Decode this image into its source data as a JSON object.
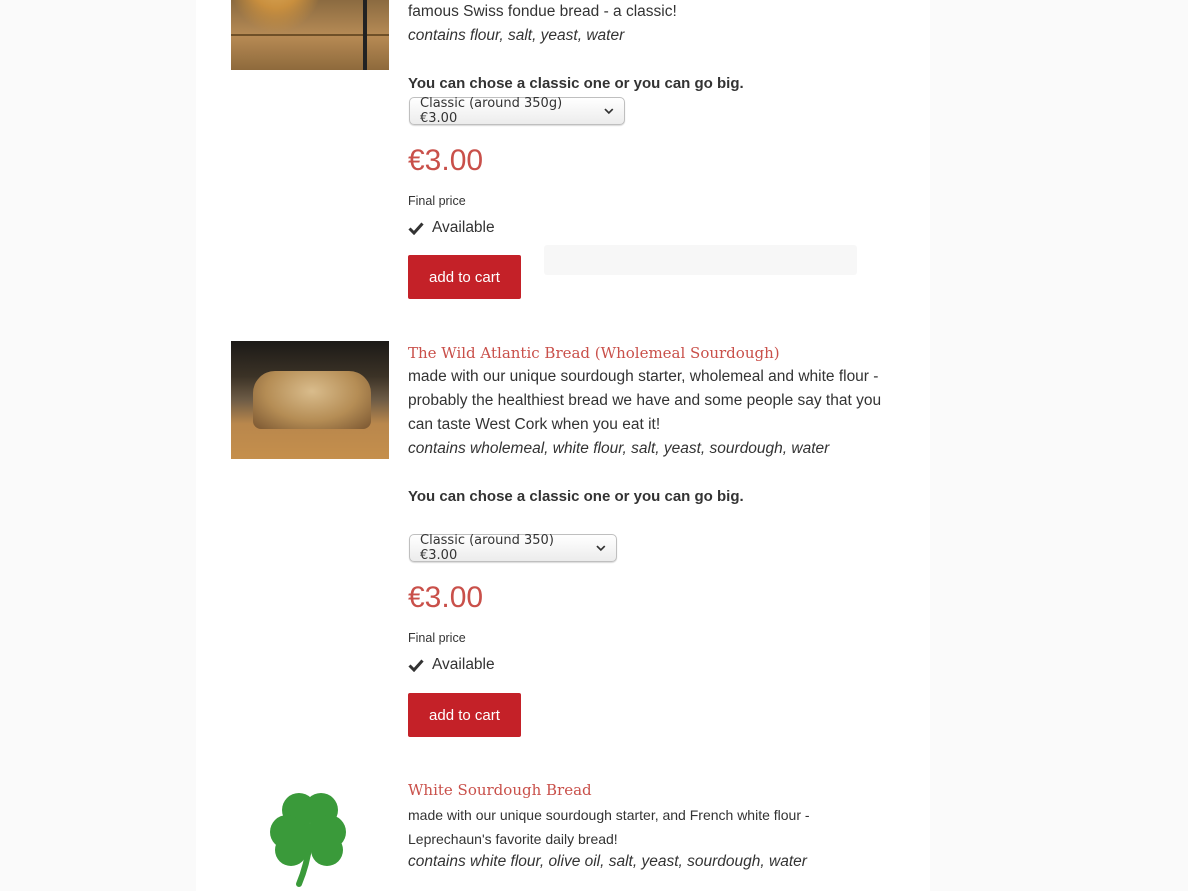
{
  "products": [
    {
      "title": "",
      "description": "famous Swiss fondue bread - a classic!",
      "contains": "contains flour, salt, yeast, water",
      "size_prompt": "You can chose a classic one or you can go big.",
      "size_select": "Classic (around 350g) €3.00",
      "price": "€3.00",
      "final_price_label": "Final price",
      "availability": "Available",
      "cart_label": "add to cart"
    },
    {
      "title": "The Wild Atlantic Bread (Wholemeal Sourdough)",
      "description_lines": [
        "made with our unique sourdough starter, wholemeal and white flour -",
        "probably the healthiest bread we have and some people say that you",
        "can taste West Cork when you eat it!"
      ],
      "contains": "contains wholemeal, white flour, salt, yeast, sourdough, water",
      "size_prompt": "You can chose a classic one or you can go big.",
      "size_select": "Classic (around 350) €3.00",
      "price": "€3.00",
      "final_price_label": "Final price",
      "availability": "Available",
      "cart_label": "add to cart"
    },
    {
      "title": "White Sourdough Bread",
      "description_lines": [
        "made with our unique sourdough starter,  and French white flour -",
        "Leprechaun's favorite daily bread!"
      ],
      "contains": "contains white flour, olive oil, salt, yeast, sourdough, water"
    }
  ],
  "icons": {
    "check": "check-icon",
    "chevron": "chevron-down-icon",
    "shamrock": "shamrock-icon"
  },
  "colors": {
    "accent": "#c9504a",
    "button": "#c42128",
    "shamrock": "#3a9a3a"
  }
}
